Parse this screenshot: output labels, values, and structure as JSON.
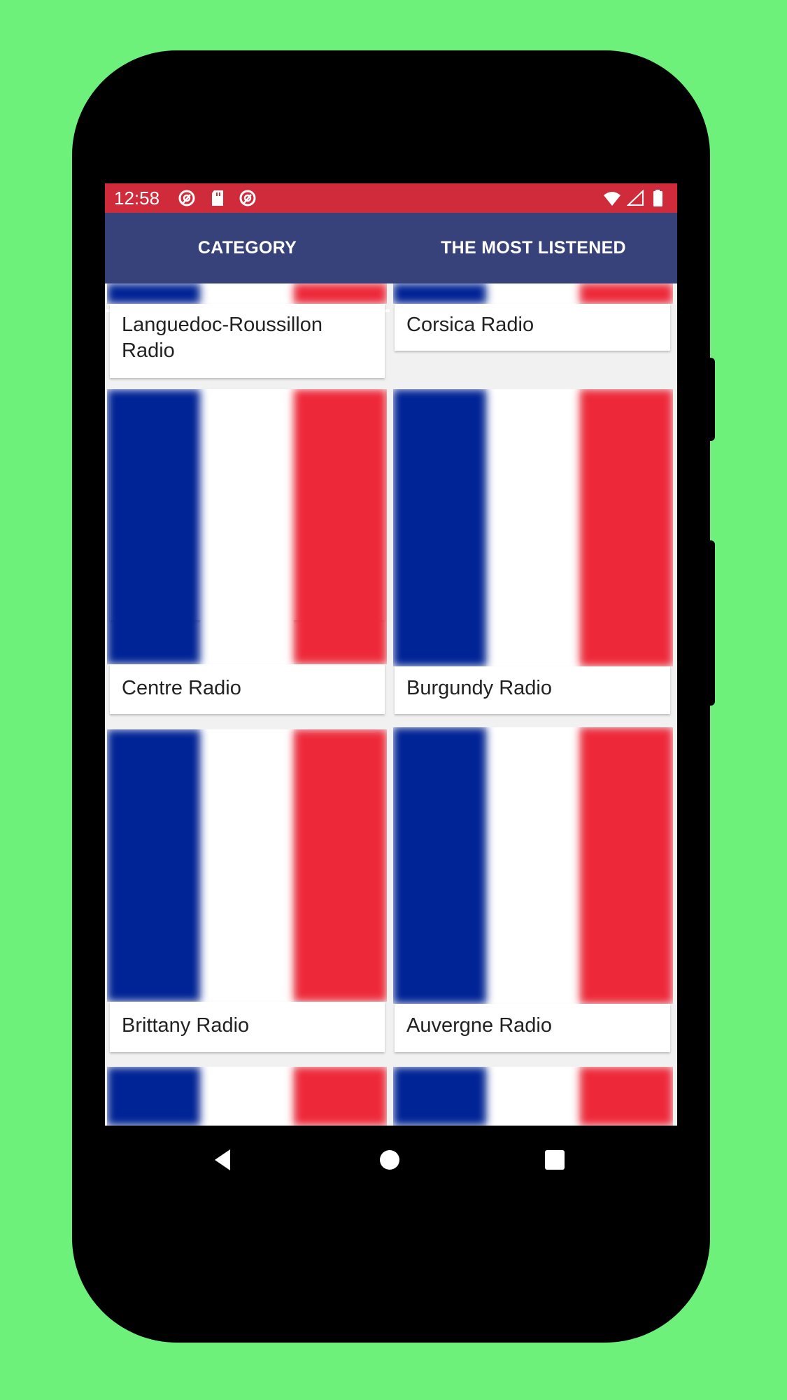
{
  "status_bar": {
    "time": "12:58",
    "left_icons": [
      "sync-off-icon",
      "sd-card-icon",
      "sync-off-icon"
    ],
    "right_icons": [
      "wifi-icon",
      "signal-icon",
      "battery-icon"
    ]
  },
  "tabs": [
    {
      "label": "CATEGORY",
      "selected": true
    },
    {
      "label": "THE MOST LISTENED",
      "selected": false
    }
  ],
  "categories": [
    {
      "label": "Languedoc-Roussillon Radio",
      "image": "french-flag"
    },
    {
      "label": "Corsica Radio",
      "image": "french-flag"
    },
    {
      "label": "Centre Radio",
      "image": "french-flag"
    },
    {
      "label": "Burgundy Radio",
      "image": "french-flag"
    },
    {
      "label": "Brittany Radio",
      "image": "french-flag"
    },
    {
      "label": "Auvergne Radio",
      "image": "french-flag"
    },
    {
      "label": "",
      "image": "french-flag"
    },
    {
      "label": "",
      "image": "french-flag"
    }
  ],
  "nav_bar": {
    "back": "back-icon",
    "home": "home-icon",
    "recents": "recents-icon"
  },
  "colors": {
    "status_bar": "#D02B3A",
    "tab_bar": "#37417A",
    "background": "#F1F1F1",
    "flag_blue": "#002395",
    "flag_red": "#ED2939"
  }
}
